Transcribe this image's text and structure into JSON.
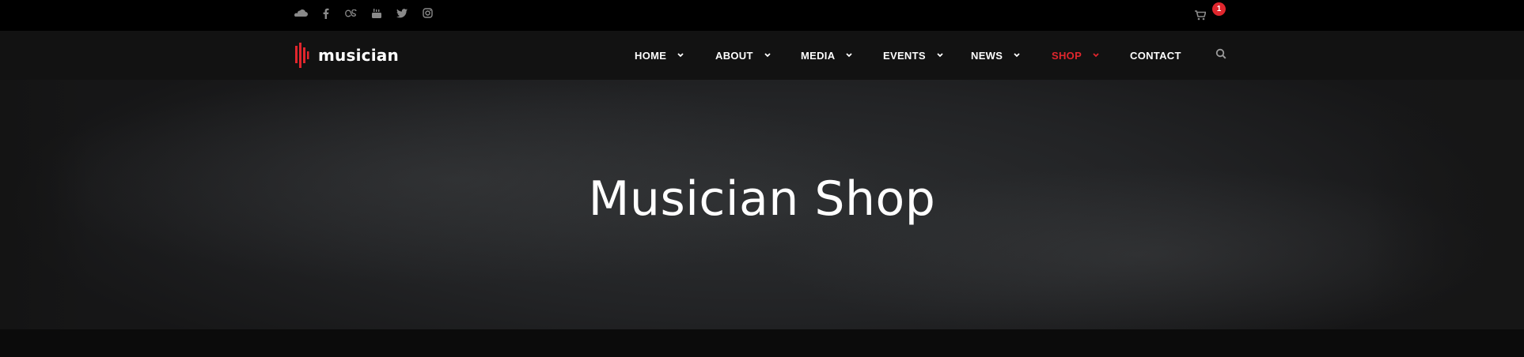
{
  "topbar": {
    "social_icons": [
      "soundcloud-icon",
      "facebook-icon",
      "lastfm-icon",
      "youtube-icon",
      "twitter-icon",
      "instagram-icon"
    ],
    "cart_count": "1"
  },
  "brand": {
    "name": "musician",
    "accent_color": "#e0262d"
  },
  "nav": {
    "items": [
      {
        "label": "HOME",
        "has_dropdown": true
      },
      {
        "label": "ABOUT",
        "has_dropdown": true
      },
      {
        "label": "MEDIA",
        "has_dropdown": true
      },
      {
        "label": "EVENTS",
        "has_dropdown": true
      },
      {
        "label": "NEWS",
        "has_dropdown": true
      },
      {
        "label": "SHOP",
        "has_dropdown": true,
        "active": true
      },
      {
        "label": "CONTACT",
        "has_dropdown": false
      }
    ]
  },
  "hero": {
    "title": "Musician Shop"
  }
}
